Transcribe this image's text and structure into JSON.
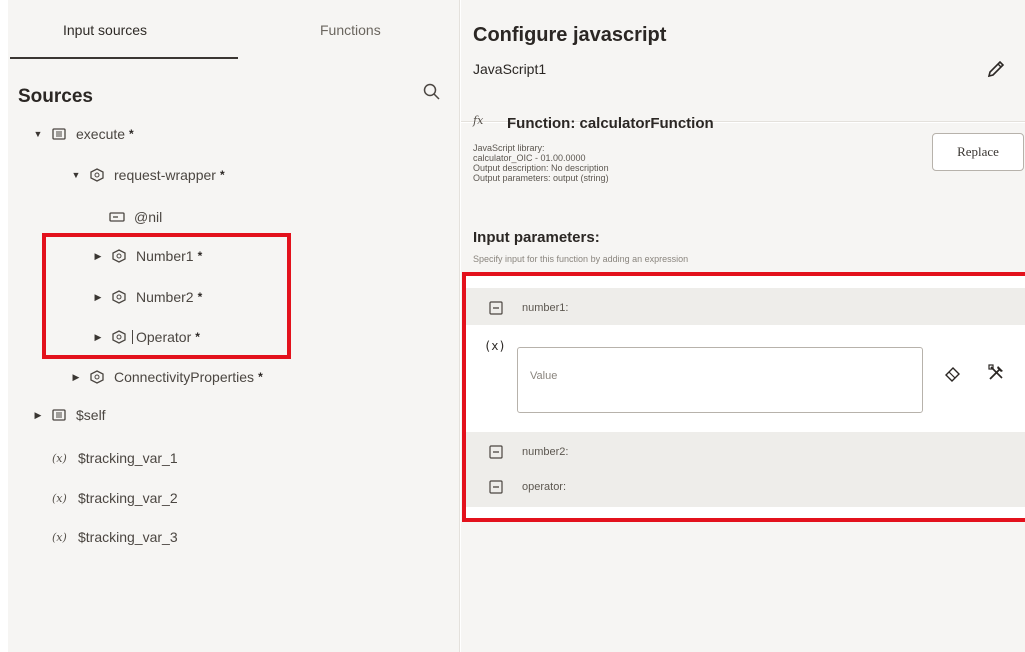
{
  "tabs": {
    "input_sources": "Input sources",
    "functions": "Functions"
  },
  "sources": {
    "title": "Sources",
    "tree": [
      {
        "label": "execute",
        "required": "*",
        "icon": "element-icon",
        "caret": "▼"
      },
      {
        "label": "request-wrapper",
        "required": "*",
        "icon": "complex-type-icon",
        "caret": "▼"
      },
      {
        "label": "@nil",
        "required": "",
        "icon": "attribute-icon",
        "caret": ""
      },
      {
        "label": "Number1",
        "required": "*",
        "icon": "complex-type-icon",
        "caret": "▶"
      },
      {
        "label": "Number2",
        "required": "*",
        "icon": "complex-type-icon",
        "caret": "▶"
      },
      {
        "label": "Operator",
        "required": "*",
        "icon": "complex-type-icon",
        "caret": "▶"
      },
      {
        "label": "ConnectivityProperties",
        "required": "*",
        "icon": "complex-type-icon",
        "caret": "▶"
      },
      {
        "label": "$self",
        "required": "",
        "icon": "element-icon",
        "caret": "▶"
      },
      {
        "label": "$tracking_var_1",
        "required": "",
        "icon": "variable-icon",
        "caret": ""
      },
      {
        "label": "$tracking_var_2",
        "required": "",
        "icon": "variable-icon",
        "caret": ""
      },
      {
        "label": "$tracking_var_3",
        "required": "",
        "icon": "variable-icon",
        "caret": ""
      }
    ]
  },
  "config": {
    "title": "Configure javascript",
    "name": "JavaScript1",
    "function_prefix": "fx",
    "function_title": "Function: calculatorFunction",
    "replace_label": "Replace",
    "meta": [
      "JavaScript library:",
      "calculator_OIC - 01.00.0000",
      "Output description: No description",
      "Output parameters: output (string)"
    ],
    "input_params_title": "Input parameters:",
    "input_params_hint": "Specify input for this function by adding an expression",
    "params": [
      {
        "label": "number1:"
      },
      {
        "label": "number2:"
      },
      {
        "label": "operator:"
      }
    ],
    "expression_icon": "(x)",
    "value_placeholder": "Value"
  },
  "colors": {
    "highlight": "#e3111c",
    "panel_bg": "#f6f5f3",
    "text": "#3a3632"
  }
}
